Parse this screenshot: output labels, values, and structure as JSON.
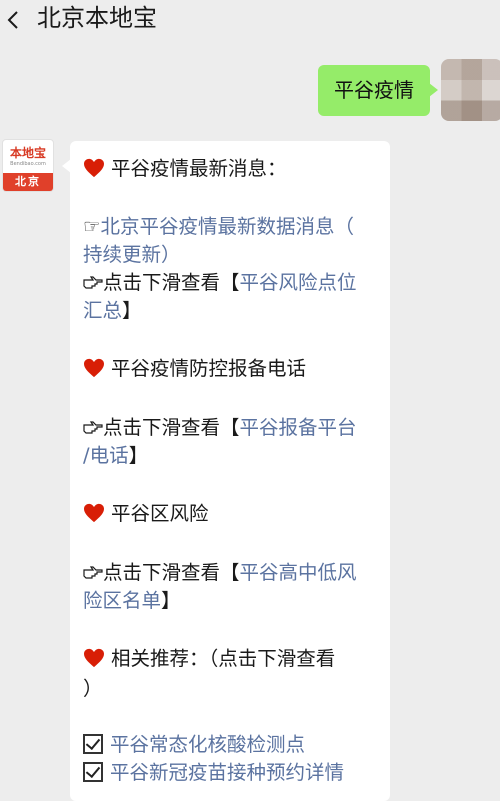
{
  "header": {
    "title": "北京本地宝",
    "back_icon": "chevron-left-icon"
  },
  "outgoing": {
    "text": "平谷疫情"
  },
  "incoming_avatar": {
    "logo_text": "本地宝",
    "logo_sub": "Bendibao.com",
    "city": "北京"
  },
  "message": {
    "sections": [
      {
        "heading": "平谷疫情最新消息：",
        "lines": [
          {
            "pre": "☞",
            "link": "北京平谷疫情最新数据消息（",
            "link2": "持续更新）"
          },
          {
            "pre": "点击下滑查看【",
            "link": "平谷风险点位",
            "link2": "汇总",
            "post": "】"
          }
        ]
      },
      {
        "heading": "平谷疫情防控报备电话",
        "lines": [
          {
            "pre": "点击下滑查看【",
            "link": "平谷报备平台",
            "link2": "/电话",
            "post": "】"
          }
        ]
      },
      {
        "heading": "平谷区风险",
        "lines": [
          {
            "pre": "点击下滑查看【",
            "link": "平谷高中低风",
            "link2": "险区名单",
            "post": "】"
          }
        ]
      },
      {
        "heading": "相关推荐：（点击下滑查看",
        "heading2": "）"
      }
    ],
    "checklist": [
      "平谷常态化核酸检测点",
      "平谷新冠疫苗接种预约详情"
    ]
  },
  "colors": {
    "bubble_self": "#95ec69",
    "link": "#5b73a0",
    "heart": "#d81e06",
    "background": "#ededed"
  }
}
